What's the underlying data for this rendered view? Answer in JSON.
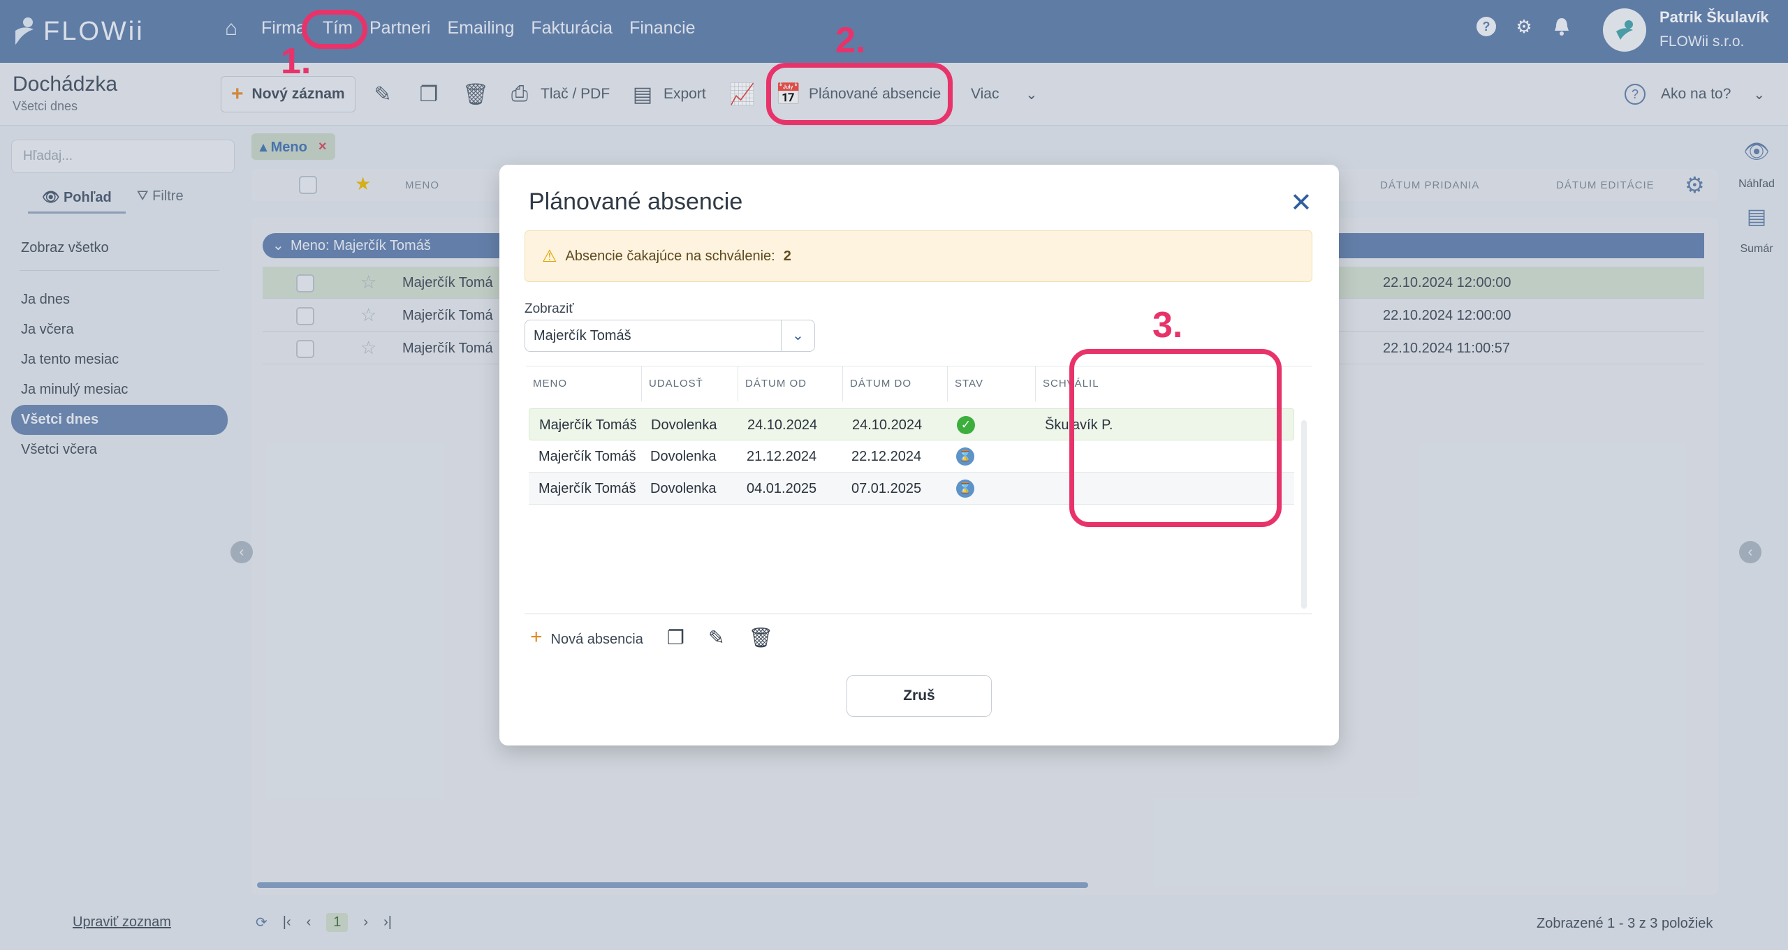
{
  "app": {
    "brand": "FLOWii",
    "nav": [
      "Firma",
      "Tím",
      "Partneri",
      "Emailing",
      "Fakturácia",
      "Financie"
    ],
    "user_name": "Patrik Škulavík",
    "company": "FLOWii s.r.o."
  },
  "page": {
    "title": "Dochádzka",
    "subtitle": "Všetci dnes"
  },
  "toolbar": {
    "new": "Nový záznam",
    "print": "Tlač / PDF",
    "export": "Export",
    "planned": "Plánované absencie",
    "more": "Viac",
    "help": "Ako na to?"
  },
  "sidebar": {
    "search_placeholder": "Hľadaj...",
    "view_tab": "Pohľad",
    "filter_tab": "Filtre",
    "show_all": "Zobraz všetko",
    "items": [
      "Ja dnes",
      "Ja včera",
      "Ja tento mesiac",
      "Ja minulý mesiac",
      "Všetci dnes",
      "Všetci včera"
    ],
    "active_item": "Všetci dnes",
    "edit_list": "Upraviť zoznam"
  },
  "grid": {
    "filter_tag": "Meno",
    "col_name": "MENO",
    "col_added": "DÁTUM PRIDANIA",
    "col_edited": "DÁTUM EDITÁCIE",
    "group_label": "Meno: Majerčík Tomáš",
    "rows": [
      {
        "name": "Majerčík Tomá",
        "date": "22.10.2024 12:00:00"
      },
      {
        "name": "Majerčík Tomá",
        "date": "22.10.2024 12:00:00"
      },
      {
        "name": "Majerčík Tomá",
        "date": "22.10.2024 11:00:57"
      }
    ],
    "page": "1",
    "count_info": "Zobrazené 1 - 3 z 3 položiek"
  },
  "right_panel": {
    "preview": "Náhľad",
    "summary": "Sumár"
  },
  "annotations": [
    "1.",
    "2.",
    "3."
  ],
  "modal": {
    "title": "Plánované absencie",
    "alert_prefix": "Absencie čakajúce na schválenie:",
    "alert_count": "2",
    "show_label": "Zobraziť",
    "show_value": "Majerčík Tomáš",
    "columns": [
      "MENO",
      "UDALOSŤ",
      "DÁTUM OD",
      "DÁTUM DO",
      "STAV",
      "SCHVÁLIL"
    ],
    "rows": [
      {
        "name": "Majerčík Tomáš",
        "event": "Dovolenka",
        "from": "24.10.2024",
        "to": "24.10.2024",
        "status": "approved",
        "approved_by": "Škulavík P."
      },
      {
        "name": "Majerčík Tomáš",
        "event": "Dovolenka",
        "from": "21.12.2024",
        "to": "22.12.2024",
        "status": "pending",
        "approved_by": ""
      },
      {
        "name": "Majerčík Tomáš",
        "event": "Dovolenka",
        "from": "04.01.2025",
        "to": "07.01.2025",
        "status": "pending",
        "approved_by": ""
      }
    ],
    "new_absence": "Nová absencia",
    "cancel": "Zruš"
  },
  "colors": {
    "accent_pink": "#e8336a",
    "topbar": "#5a7aa8",
    "approved": "#3cae3c",
    "pending": "#5c93c8"
  }
}
